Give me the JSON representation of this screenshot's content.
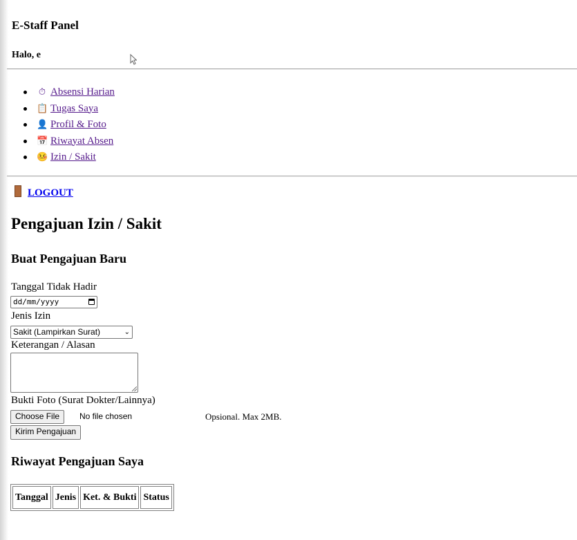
{
  "app": {
    "title": "E-Staff Panel",
    "greeting": "Halo, e"
  },
  "nav": {
    "items": [
      {
        "label": "Absensi Harian",
        "icon": "stopwatch-icon",
        "glyph": "⏱"
      },
      {
        "label": "Tugas Saya",
        "icon": "clipboard-icon",
        "glyph": "📋"
      },
      {
        "label": "Profil & Foto",
        "icon": "user-icon",
        "glyph": "👤"
      },
      {
        "label": "Riwayat Absen",
        "icon": "calendar-icon",
        "glyph": "📅"
      },
      {
        "label": "Izin / Sakit",
        "icon": "sick-face-icon",
        "glyph": "🤒"
      }
    ],
    "logout_label": "LOGOUT",
    "logout_icon": "door-icon"
  },
  "main": {
    "page_title": "Pengajuan Izin / Sakit",
    "form": {
      "section_title": "Buat Pengajuan Baru",
      "date_label": "Tanggal Tidak Hadir",
      "date_placeholder": "dd/mm/yyyy",
      "type_label": "Jenis Izin",
      "type_selected": "Sakit (Lampirkan Surat)",
      "reason_label": "Keterangan / Alasan",
      "reason_value": "",
      "proof_label": "Bukti Foto (Surat Dokter/Lainnya)",
      "file_button": "Choose File",
      "file_status": "No file chosen",
      "file_hint": "Opsional. Max 2MB.",
      "submit_label": "Kirim Pengajuan"
    },
    "history": {
      "section_title": "Riwayat Pengajuan Saya",
      "columns": [
        "Tanggal",
        "Jenis",
        "Ket. & Bukti",
        "Status"
      ]
    }
  },
  "colors": {
    "visited_link": "#551a8b",
    "link": "#0000ee",
    "button_bg": "#efefef",
    "border": "#767676"
  }
}
